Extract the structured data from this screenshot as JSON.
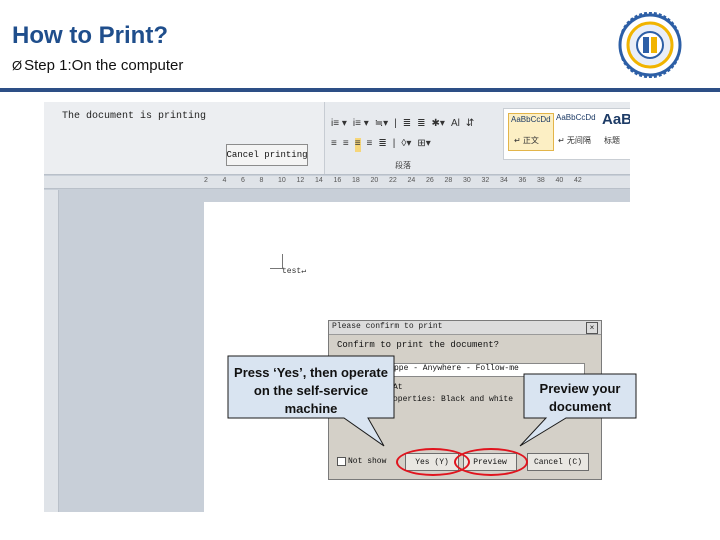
{
  "slide": {
    "title": "How to Print?",
    "step_bullet": "Ø",
    "step": "Step 1:On the computer"
  },
  "screenshot": {
    "status_message": "The document is printing",
    "cancel_button": "Cancel printing",
    "ribbon": {
      "row1": [
        "i≡ ▾",
        "i≡ ▾",
        "≒▾",
        "|",
        "≣",
        "≣",
        "✱▾",
        "Al",
        "⇵"
      ],
      "row2": [
        "≡",
        "≡",
        "≡",
        "≡",
        "≣",
        "|",
        "◊▾",
        "⊞▾"
      ],
      "group_label": "段落",
      "styles": [
        {
          "sample": "AaBbCcDd",
          "name": "↵ 正文"
        },
        {
          "sample": "AaBbCcDd",
          "name": "↵ 无间隔"
        },
        {
          "sample": "AaB",
          "name": "标题"
        }
      ]
    },
    "ruler_ticks": [
      "2",
      "4",
      "6",
      "8",
      "10",
      "12",
      "14",
      "16",
      "18",
      "20",
      "22",
      "24",
      "26",
      "28",
      "30",
      "32",
      "34",
      "36",
      "38",
      "40",
      "42"
    ],
    "doc_text": "test↵",
    "dialog": {
      "title": "Please confirm to print",
      "close": "×",
      "question": "Confirm to print the document?",
      "field_value": "ppe - Anywhere - Follow-me",
      "line1": "At",
      "line2": "operties: Black and white",
      "checkbox_label": "Not show",
      "buttons": {
        "yes": "Yes (Y)",
        "preview": "Preview",
        "cancel": "Cancel (C)"
      }
    }
  },
  "callouts": {
    "yes_note": "Press ‘Yes’, then operate on the self-service machine",
    "preview_note": "Preview your document"
  },
  "colors": {
    "title": "#1f4e8c",
    "rule": "#2d4f86",
    "highlight_ring": "#e0141e"
  }
}
